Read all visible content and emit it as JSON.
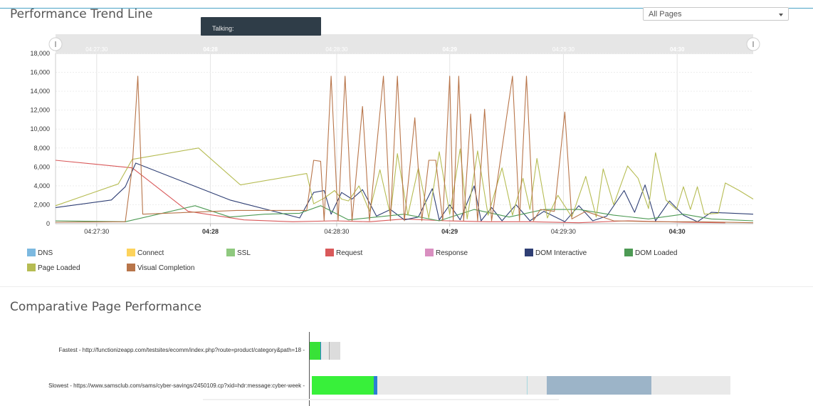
{
  "trend": {
    "title": "Performance Trend Line",
    "page_select": "All Pages",
    "tooltip": "Talking:"
  },
  "chart_data": {
    "type": "line",
    "title": "Performance Trend Line",
    "ylim": [
      0,
      18000
    ],
    "y_ticks": [
      "0",
      "2,000",
      "4,000",
      "6,000",
      "8,000",
      "10,000",
      "12,000",
      "14,000",
      "16,000",
      "18,000"
    ],
    "x_range_seconds": [
      "04:27:15",
      "04:30:26"
    ],
    "x_ticks": [
      {
        "label": "04:27:30",
        "bold": false
      },
      {
        "label": "04:28",
        "bold": true
      },
      {
        "label": "04:28:30",
        "bold": false
      },
      {
        "label": "04:29",
        "bold": true
      },
      {
        "label": "04:29:30",
        "bold": false
      },
      {
        "label": "04:30",
        "bold": true
      }
    ],
    "navigator_ticks": [
      {
        "label": "04:27:30",
        "bold": false
      },
      {
        "label": "04:28",
        "bold": true
      },
      {
        "label": "04:28:30",
        "bold": false
      },
      {
        "label": "04:29",
        "bold": true
      },
      {
        "label": "04:29:30",
        "bold": false
      },
      {
        "label": "04:30",
        "bold": true
      }
    ],
    "grid": true,
    "legend_position": "bottom",
    "series": [
      {
        "name": "DNS",
        "color": "#7cb9e0",
        "values": []
      },
      {
        "name": "Connect",
        "color": "#fdd35c",
        "values": []
      },
      {
        "name": "SSL",
        "color": "#8fc97f",
        "values": []
      },
      {
        "name": "Request",
        "color": "#d9595a",
        "values": [
          [
            0,
            6700
          ],
          [
            11,
            5900
          ],
          [
            19,
            1300
          ],
          [
            27,
            400
          ],
          [
            34,
            200
          ],
          [
            40,
            300
          ],
          [
            45,
            200
          ],
          [
            50,
            500
          ],
          [
            56,
            300
          ],
          [
            62,
            200
          ],
          [
            68,
            200
          ],
          [
            75,
            100
          ],
          [
            82,
            300
          ],
          [
            90,
            150
          ],
          [
            96,
            100
          ]
        ]
      },
      {
        "name": "Response",
        "color": "#d98fc0",
        "values": []
      },
      {
        "name": "DOM Interactive",
        "color": "#2f3f74",
        "values": [
          [
            0,
            1700
          ],
          [
            8,
            2500
          ],
          [
            10,
            3900
          ],
          [
            11.5,
            6400
          ],
          [
            25,
            2500
          ],
          [
            35,
            600
          ],
          [
            37,
            3300
          ],
          [
            38.5,
            3500
          ],
          [
            39.5,
            1000
          ],
          [
            41,
            3300
          ],
          [
            42.5,
            2600
          ],
          [
            44,
            3600
          ],
          [
            46,
            800
          ],
          [
            48,
            1500
          ],
          [
            50,
            400
          ],
          [
            52,
            700
          ],
          [
            54,
            3700
          ],
          [
            55,
            400
          ],
          [
            56.5,
            2000
          ],
          [
            58,
            400
          ],
          [
            60,
            4000
          ],
          [
            61,
            300
          ],
          [
            62.5,
            1700
          ],
          [
            64,
            300
          ],
          [
            66,
            2000
          ],
          [
            68,
            300
          ],
          [
            70,
            1300
          ],
          [
            73,
            200
          ],
          [
            75,
            1900
          ],
          [
            77,
            300
          ],
          [
            79,
            800
          ],
          [
            81.5,
            3500
          ],
          [
            83,
            1200
          ],
          [
            84.5,
            4100
          ],
          [
            86,
            300
          ],
          [
            88,
            2400
          ],
          [
            90,
            900
          ],
          [
            92,
            200
          ],
          [
            94,
            1200
          ],
          [
            100,
            1000
          ]
        ]
      },
      {
        "name": "DOM Loaded",
        "color": "#4d9a54",
        "values": [
          [
            0,
            300
          ],
          [
            10,
            200
          ],
          [
            20,
            1900
          ],
          [
            25,
            700
          ],
          [
            30,
            1000
          ],
          [
            35,
            1100
          ],
          [
            38,
            1900
          ],
          [
            42,
            400
          ],
          [
            50,
            1000
          ],
          [
            55,
            300
          ],
          [
            60,
            1500
          ],
          [
            65,
            700
          ],
          [
            70,
            1500
          ],
          [
            75,
            1500
          ],
          [
            80,
            900
          ],
          [
            85,
            500
          ],
          [
            90,
            1000
          ],
          [
            94,
            500
          ],
          [
            100,
            300
          ]
        ]
      },
      {
        "name": "Page Loaded",
        "color": "#b6bc53",
        "values": [
          [
            0,
            1900
          ],
          [
            9,
            4200
          ],
          [
            11,
            6800
          ],
          [
            20.5,
            8000
          ],
          [
            26.5,
            4100
          ],
          [
            36,
            5300
          ],
          [
            37,
            2100
          ],
          [
            38.5,
            2700
          ],
          [
            40,
            3500
          ],
          [
            41,
            2600
          ],
          [
            42,
            2400
          ],
          [
            43.5,
            4000
          ],
          [
            45,
            1300
          ],
          [
            46.5,
            5700
          ],
          [
            48,
            900
          ],
          [
            49,
            7400
          ],
          [
            50.5,
            900
          ],
          [
            52,
            5900
          ],
          [
            53.5,
            600
          ],
          [
            55,
            7600
          ],
          [
            56.5,
            1000
          ],
          [
            58,
            7900
          ],
          [
            59,
            500
          ],
          [
            60.5,
            7700
          ],
          [
            62,
            900
          ],
          [
            64,
            5900
          ],
          [
            65.5,
            900
          ],
          [
            67,
            4800
          ],
          [
            68,
            1500
          ],
          [
            69,
            6900
          ],
          [
            70.5,
            600
          ],
          [
            72,
            3000
          ],
          [
            74,
            700
          ],
          [
            76,
            5000
          ],
          [
            77.5,
            700
          ],
          [
            78.5,
            5800
          ],
          [
            80,
            2000
          ],
          [
            82,
            6100
          ],
          [
            83.5,
            4800
          ],
          [
            85,
            1600
          ],
          [
            86,
            7500
          ],
          [
            87.5,
            2500
          ],
          [
            89,
            1500
          ],
          [
            90,
            3900
          ],
          [
            91,
            1500
          ],
          [
            92,
            3900
          ],
          [
            93,
            1000
          ],
          [
            95,
            1100
          ],
          [
            96,
            4300
          ],
          [
            98,
            3500
          ],
          [
            100,
            2600
          ]
        ]
      },
      {
        "name": "Visual Completion",
        "color": "#b8754a",
        "values": [
          [
            0,
            150
          ],
          [
            10,
            200
          ],
          [
            11,
            6000
          ],
          [
            11.8,
            15600
          ],
          [
            12.5,
            1000
          ],
          [
            26,
            1400
          ],
          [
            36,
            1400
          ],
          [
            37,
            6700
          ],
          [
            38,
            6600
          ],
          [
            38.5,
            300
          ],
          [
            39.5,
            15600
          ],
          [
            40.5,
            300
          ],
          [
            41.5,
            15600
          ],
          [
            42.5,
            300
          ],
          [
            44,
            12400
          ],
          [
            45,
            300
          ],
          [
            47,
            15600
          ],
          [
            48,
            300
          ],
          [
            49,
            15600
          ],
          [
            50,
            300
          ],
          [
            51.5,
            11200
          ],
          [
            52.5,
            300
          ],
          [
            53.5,
            6700
          ],
          [
            54.5,
            6700
          ],
          [
            55.5,
            300
          ],
          [
            56.5,
            15600
          ],
          [
            57,
            300
          ],
          [
            57.8,
            15600
          ],
          [
            58.5,
            300
          ],
          [
            59.5,
            11600
          ],
          [
            60.5,
            300
          ],
          [
            61.5,
            12100
          ],
          [
            62.5,
            300
          ],
          [
            65.5,
            15600
          ],
          [
            66.5,
            300
          ],
          [
            67.5,
            15600
          ],
          [
            68.5,
            300
          ],
          [
            69.5,
            1500
          ],
          [
            71.5,
            1300
          ],
          [
            73,
            11800
          ],
          [
            74,
            500
          ],
          [
            76,
            1300
          ],
          [
            80,
            300
          ],
          [
            86,
            200
          ],
          [
            92,
            200
          ],
          [
            100,
            100
          ]
        ]
      }
    ]
  },
  "comparative": {
    "title": "Comparative Page Performance",
    "rows": [
      {
        "label": "Fastest - http://functionizeapp.com/testsites/ecomm/index.php?route=product/category&path=18 -",
        "segments": [
          {
            "start": 0.0,
            "end": 0.34,
            "color": "#38e238"
          },
          {
            "start": 0.34,
            "end": 0.38,
            "color": "#2b7fd4"
          },
          {
            "start": 0.38,
            "end": 0.62,
            "color": "#e9e9e9"
          },
          {
            "start": 0.62,
            "end": 0.66,
            "color": "#a6a6a6"
          },
          {
            "start": 0.66,
            "end": 1.0,
            "color": "#dcdcdc"
          }
        ]
      },
      {
        "label": "Slowest - https://www.samsclub.com/sams/cyber-savings/2450109.cp?xid=hdr:message:cyber-week -",
        "segments": [
          {
            "start": 0.0,
            "end": 0.148,
            "color": "#38f03a"
          },
          {
            "start": 0.148,
            "end": 0.156,
            "color": "#2b7fd4"
          },
          {
            "start": 0.156,
            "end": 0.514,
            "color": "#e9e9e9"
          },
          {
            "start": 0.514,
            "end": 0.516,
            "color": "#a7d8e0"
          },
          {
            "start": 0.516,
            "end": 0.562,
            "color": "#e9e9e9"
          },
          {
            "start": 0.562,
            "end": 0.812,
            "color": "#9cb4c8"
          },
          {
            "start": 0.812,
            "end": 1.0,
            "color": "#e9e9e9"
          }
        ]
      }
    ]
  }
}
